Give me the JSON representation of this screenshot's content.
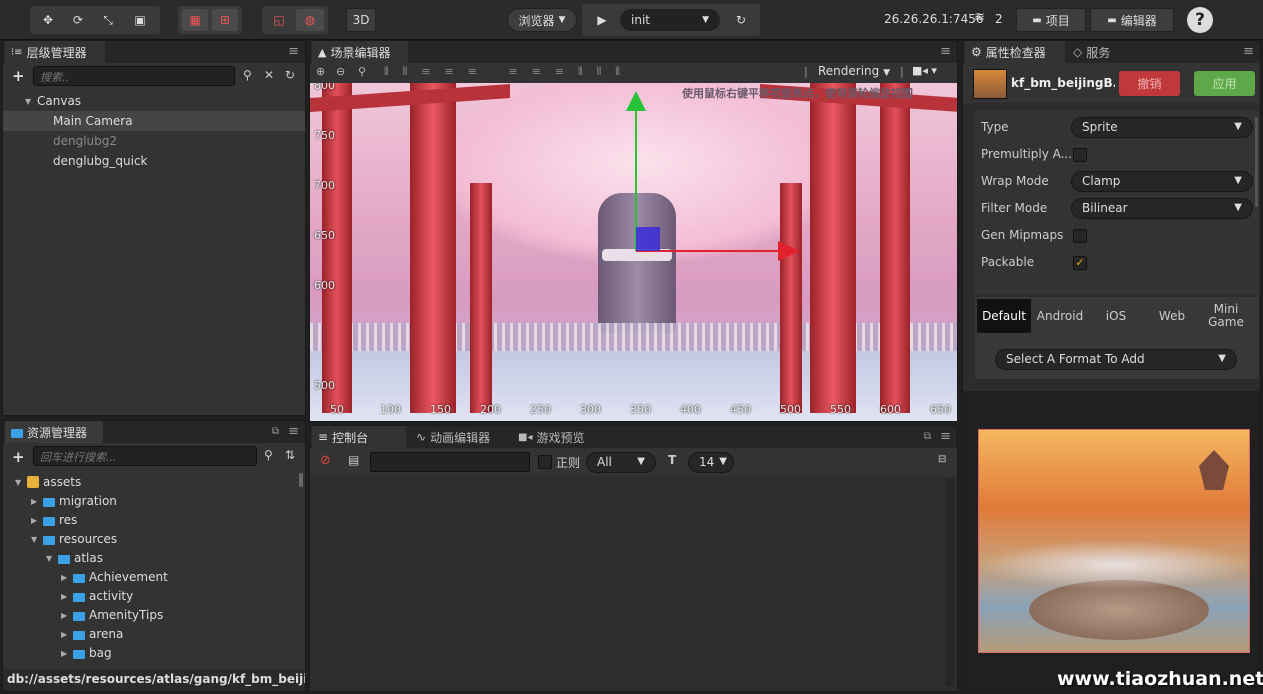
{
  "toolbar": {
    "browser_label": "浏览器",
    "scene_select": "init",
    "mode_3d": "3D",
    "ip": "26.26.26.1:7456",
    "wifi_count": "2",
    "project_label": "项目",
    "editor_label": "编辑器",
    "help": "?"
  },
  "hierarchy": {
    "tab": "层级管理器",
    "search_placeholder": "搜索..",
    "items": [
      "Canvas",
      "Main Camera",
      "denglubg2",
      "denglubg_quick"
    ]
  },
  "scene": {
    "tab": "场景编辑器",
    "rendering": "Rendering",
    "hint": "使用鼠标右键平移视窗焦点，使用滚轮缩放视图",
    "y_labels": [
      "800",
      "750",
      "700",
      "650",
      "600",
      "500"
    ],
    "x_labels": [
      "50",
      "100",
      "150",
      "200",
      "250",
      "300",
      "350",
      "400",
      "450",
      "500",
      "550",
      "600",
      "650"
    ]
  },
  "assets": {
    "tab": "资源管理器",
    "search_placeholder": "回车进行搜索...",
    "items": [
      "assets",
      "migration",
      "res",
      "resources",
      "atlas",
      "Achievement",
      "activity",
      "AmenityTips",
      "arena",
      "bag"
    ],
    "path": "db://assets/resources/atlas/gang/kf_bm_beijingB..."
  },
  "console": {
    "tabs": [
      "控制台",
      "动画编辑器",
      "游戏预览"
    ],
    "regex_label": "正则",
    "level": "All",
    "font_size": "14"
  },
  "inspector": {
    "tabs": [
      "属性检查器",
      "服务"
    ],
    "asset_name": "kf_bm_beijingB...",
    "revert": "撤销",
    "apply": "应用",
    "props": [
      {
        "label": "Type",
        "value": "Sprite"
      },
      {
        "label": "Premultiply A...",
        "checked": false
      },
      {
        "label": "Wrap Mode",
        "value": "Clamp"
      },
      {
        "label": "Filter Mode",
        "value": "Bilinear"
      },
      {
        "label": "Gen Mipmaps",
        "checked": false
      },
      {
        "label": "Packable",
        "checked": true
      }
    ],
    "platforms": [
      "Default",
      "Android",
      "iOS",
      "Web",
      "Mini Game"
    ],
    "format_select": "Select A Format To Add"
  },
  "watermark": "www.tiaozhuan.net",
  "colors": {
    "accent": "#3ba1e5",
    "revert": "#c0373c",
    "apply": "#5fa84a"
  }
}
